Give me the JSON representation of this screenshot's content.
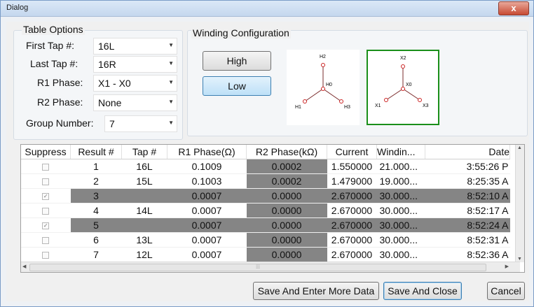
{
  "window": {
    "title": "Dialog",
    "close_symbol": "x"
  },
  "table_options": {
    "legend": "Table Options",
    "first_tap": {
      "label": "First Tap #:",
      "value": "16L"
    },
    "last_tap": {
      "label": "Last Tap #:",
      "value": "16R"
    },
    "r1_phase": {
      "label": "R1 Phase:",
      "value": "X1 - X0"
    },
    "r2_phase": {
      "label": "R2 Phase:",
      "value": "None"
    },
    "group_number": {
      "label": "Group Number:",
      "value": "7"
    }
  },
  "winding": {
    "legend": "Winding Configuration",
    "high_label": "High",
    "low_label": "Low",
    "selected": "Low",
    "high_diagram": {
      "top": "H2",
      "center": "H0",
      "left": "H1",
      "right": "H3"
    },
    "low_diagram": {
      "top": "X2",
      "center": "X0",
      "left": "X1",
      "right": "X3"
    },
    "selected_color": "#1a8f1a"
  },
  "grid": {
    "columns": [
      "Suppress",
      "Result #",
      "Tap #",
      "R1 Phase(Ω)",
      "R2 Phase(kΩ)",
      "Current",
      "Windin...",
      "Date"
    ],
    "rows": [
      {
        "suppress": false,
        "result": "1",
        "tap": "16L",
        "r1": "0.1009",
        "r2": "0.0002",
        "current": "1.550000",
        "winding": "21.000...",
        "date": "3:55:26 P",
        "highlight": false
      },
      {
        "suppress": false,
        "result": "2",
        "tap": "15L",
        "r1": "0.1003",
        "r2": "0.0002",
        "current": "1.479000",
        "winding": "19.000...",
        "date": "8:25:35 A",
        "highlight": false
      },
      {
        "suppress": true,
        "result": "3",
        "tap": "",
        "r1": "0.0007",
        "r2": "0.0000",
        "current": "2.670000",
        "winding": "30.000...",
        "date": "8:52:10 A",
        "highlight": true
      },
      {
        "suppress": false,
        "result": "4",
        "tap": "14L",
        "r1": "0.0007",
        "r2": "0.0000",
        "current": "2.670000",
        "winding": "30.000...",
        "date": "8:52:17 A",
        "highlight": false
      },
      {
        "suppress": true,
        "result": "5",
        "tap": "",
        "r1": "0.0007",
        "r2": "0.0000",
        "current": "2.670000",
        "winding": "30.000...",
        "date": "8:52:24 A",
        "highlight": true
      },
      {
        "suppress": false,
        "result": "6",
        "tap": "13L",
        "r1": "0.0007",
        "r2": "0.0000",
        "current": "2.670000",
        "winding": "30.000...",
        "date": "8:52:31 A",
        "highlight": false
      },
      {
        "suppress": false,
        "result": "7",
        "tap": "12L",
        "r1": "0.0007",
        "r2": "0.0000",
        "current": "2.670000",
        "winding": "30.000...",
        "date": "8:52:36 A",
        "highlight": false
      }
    ]
  },
  "buttons": {
    "save_more": "Save And Enter More Data",
    "save_close": "Save And Close",
    "cancel": "Cancel"
  },
  "colors": {
    "highlight_row": "#858585",
    "title_bar": "#c5d7ee"
  }
}
